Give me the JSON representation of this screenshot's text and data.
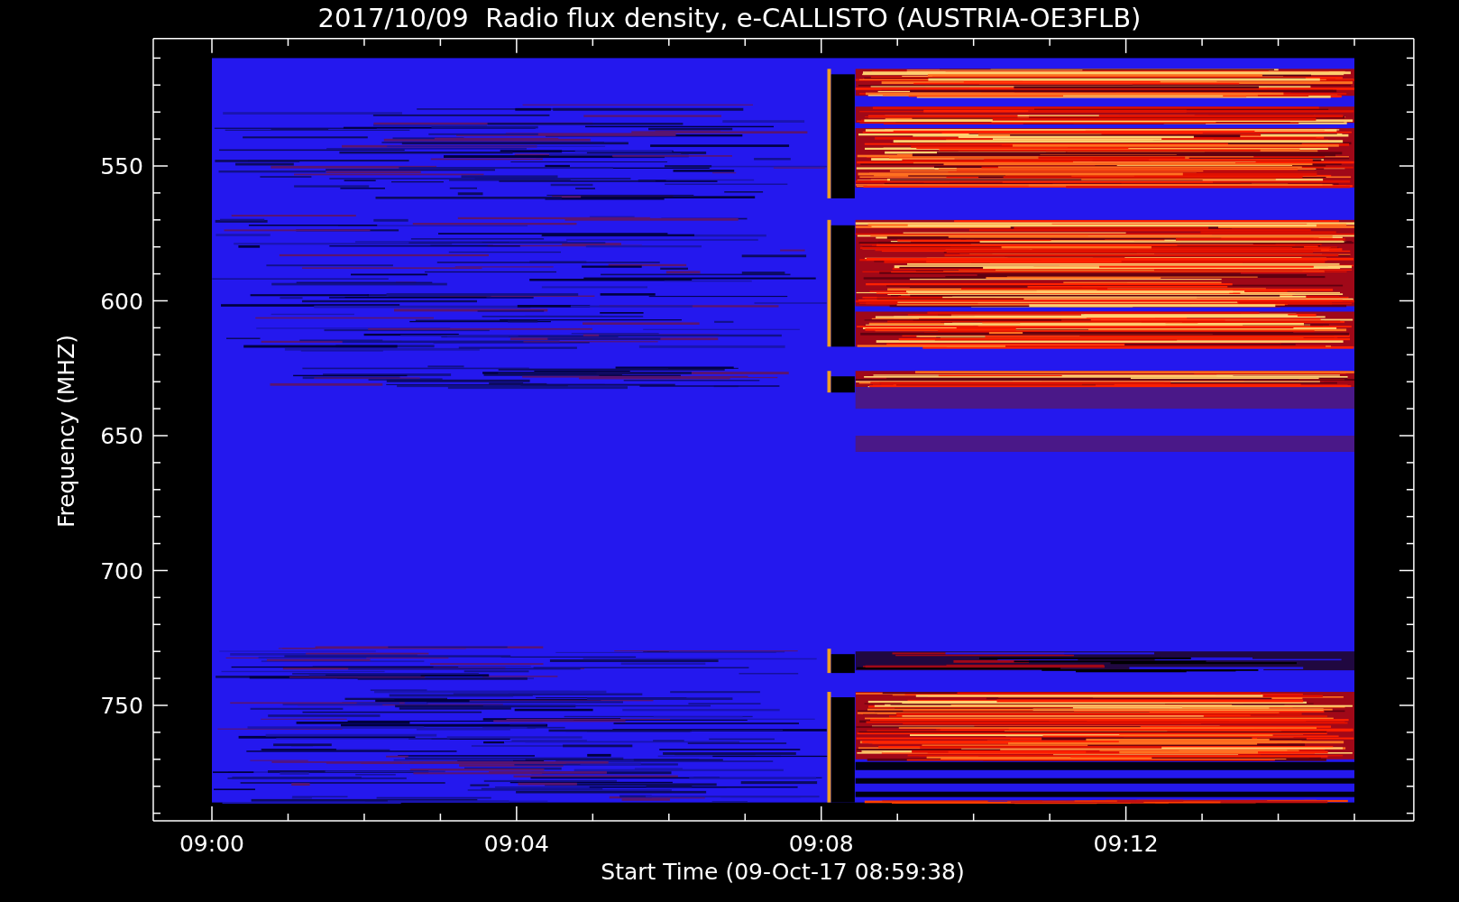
{
  "plot": {
    "title": "2017/10/09  Radio flux density, e-CALLISTO (AUSTRIA-OE3FLB)",
    "xlabel": "Start Time (09-Oct-17 08:59:38)",
    "ylabel": "Frequency (MHZ)",
    "xticks": [
      "09:00",
      "09:04",
      "09:08",
      "09:12"
    ],
    "yticks": [
      "550",
      "600",
      "650",
      "700",
      "750"
    ]
  }
}
